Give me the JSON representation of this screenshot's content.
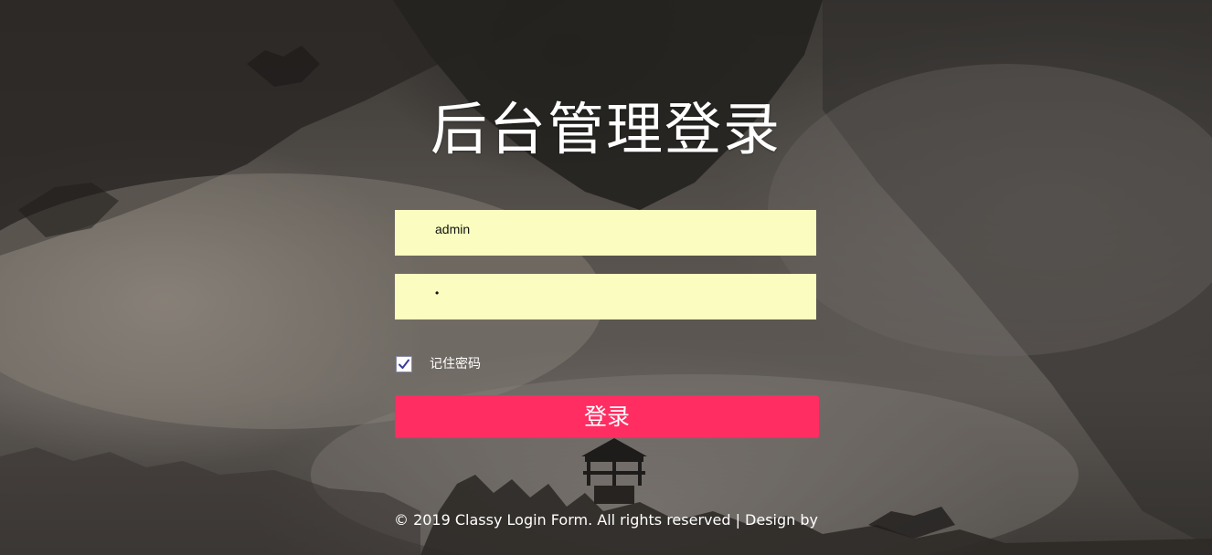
{
  "page": {
    "title": "后台管理登录"
  },
  "form": {
    "username_value": "admin",
    "password_value": "•",
    "remember_label": "记住密码",
    "remember_checked": true,
    "login_label": "登录"
  },
  "footer": {
    "text": "© 2019 Classy Login Form. All rights reserved | Design by"
  },
  "colors": {
    "input_background": "#fafdbf",
    "login_button": "#ff2d62",
    "text_light": "#ffffff"
  },
  "icons": {
    "checkbox_mark": "check-icon"
  }
}
